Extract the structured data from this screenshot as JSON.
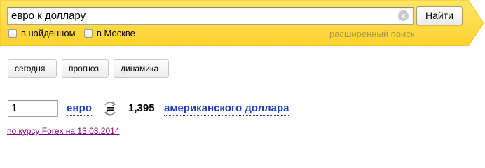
{
  "colors": {
    "header_yellow": "#ffd940",
    "link_blue": "#1a3dc1",
    "visited_link": "#800080",
    "advanced_link": "#a6924a"
  },
  "search": {
    "query": "евро к доллару",
    "button_label": "Найти",
    "clear_icon": "clear-icon",
    "options": [
      {
        "label": "в найденном",
        "checked": false
      },
      {
        "label": "в Москве",
        "checked": false
      }
    ],
    "advanced_link": "расширенный поиск"
  },
  "tabs": [
    {
      "label": "сегодня"
    },
    {
      "label": "прогноз"
    },
    {
      "label": "динамика"
    }
  ],
  "converter": {
    "amount": "1",
    "from_currency": "евро",
    "swap_icon": "swap-currency-icon",
    "rate": "1,395",
    "to_currency": "американского доллара",
    "source": "по курсу Forex на 13.03.2014"
  }
}
